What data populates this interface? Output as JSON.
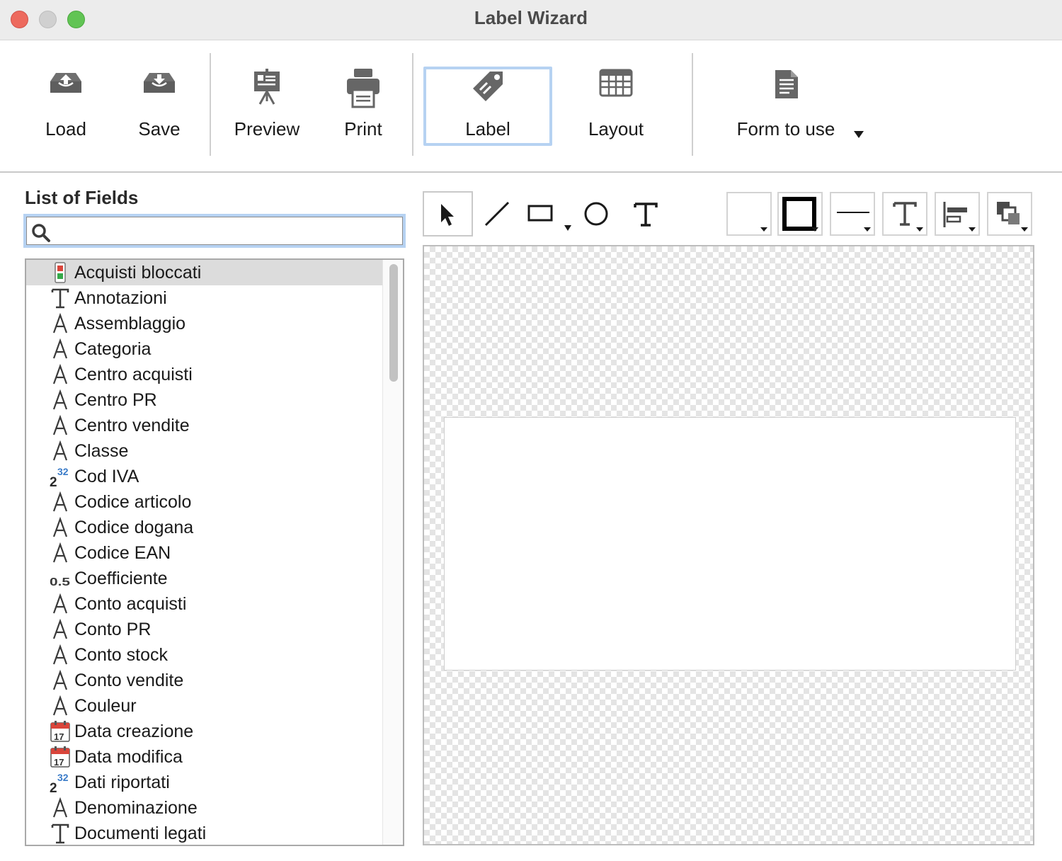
{
  "window": {
    "title": "Label Wizard"
  },
  "toolbar": {
    "load": "Load",
    "save": "Save",
    "preview": "Preview",
    "print": "Print",
    "label": "Label",
    "layout": "Layout",
    "form_to_use": "Form to use"
  },
  "fields_panel": {
    "title": "List of Fields",
    "search": {
      "value": "",
      "placeholder": ""
    },
    "items": [
      {
        "label": "Acquisti bloccati",
        "icon": "traffic-light-icon",
        "selected": true
      },
      {
        "label": "Annotazioni",
        "icon": "text-type-icon"
      },
      {
        "label": "Assemblaggio",
        "icon": "string-type-icon"
      },
      {
        "label": "Categoria",
        "icon": "string-type-icon"
      },
      {
        "label": "Centro acquisti",
        "icon": "string-type-icon"
      },
      {
        "label": "Centro PR",
        "icon": "string-type-icon"
      },
      {
        "label": "Centro vendite",
        "icon": "string-type-icon"
      },
      {
        "label": "Classe",
        "icon": "string-type-icon"
      },
      {
        "label": "Cod IVA",
        "icon": "integer-type-icon"
      },
      {
        "label": "Codice articolo",
        "icon": "string-type-icon"
      },
      {
        "label": "Codice dogana",
        "icon": "string-type-icon"
      },
      {
        "label": "Codice EAN",
        "icon": "string-type-icon"
      },
      {
        "label": "Coefficiente",
        "icon": "real-type-icon"
      },
      {
        "label": "Conto acquisti",
        "icon": "string-type-icon"
      },
      {
        "label": "Conto PR",
        "icon": "string-type-icon"
      },
      {
        "label": "Conto stock",
        "icon": "string-type-icon"
      },
      {
        "label": "Conto vendite",
        "icon": "string-type-icon"
      },
      {
        "label": "Couleur",
        "icon": "string-type-icon"
      },
      {
        "label": "Data creazione",
        "icon": "date-type-icon"
      },
      {
        "label": "Data modifica",
        "icon": "date-type-icon"
      },
      {
        "label": "Dati riportati",
        "icon": "integer-type-icon"
      },
      {
        "label": "Denominazione",
        "icon": "string-type-icon"
      },
      {
        "label": "Documenti legati",
        "icon": "text-type-icon"
      }
    ]
  },
  "icon_glyphs": {
    "integer_base": "2",
    "integer_exp": "32",
    "real": "0.5",
    "date_day": "17"
  },
  "colors": {
    "selection_border": "#b6d2f2",
    "selected_row": "#dcdcdc",
    "integer_exp": "#3a7bc8",
    "date_red": "#d9453b"
  }
}
